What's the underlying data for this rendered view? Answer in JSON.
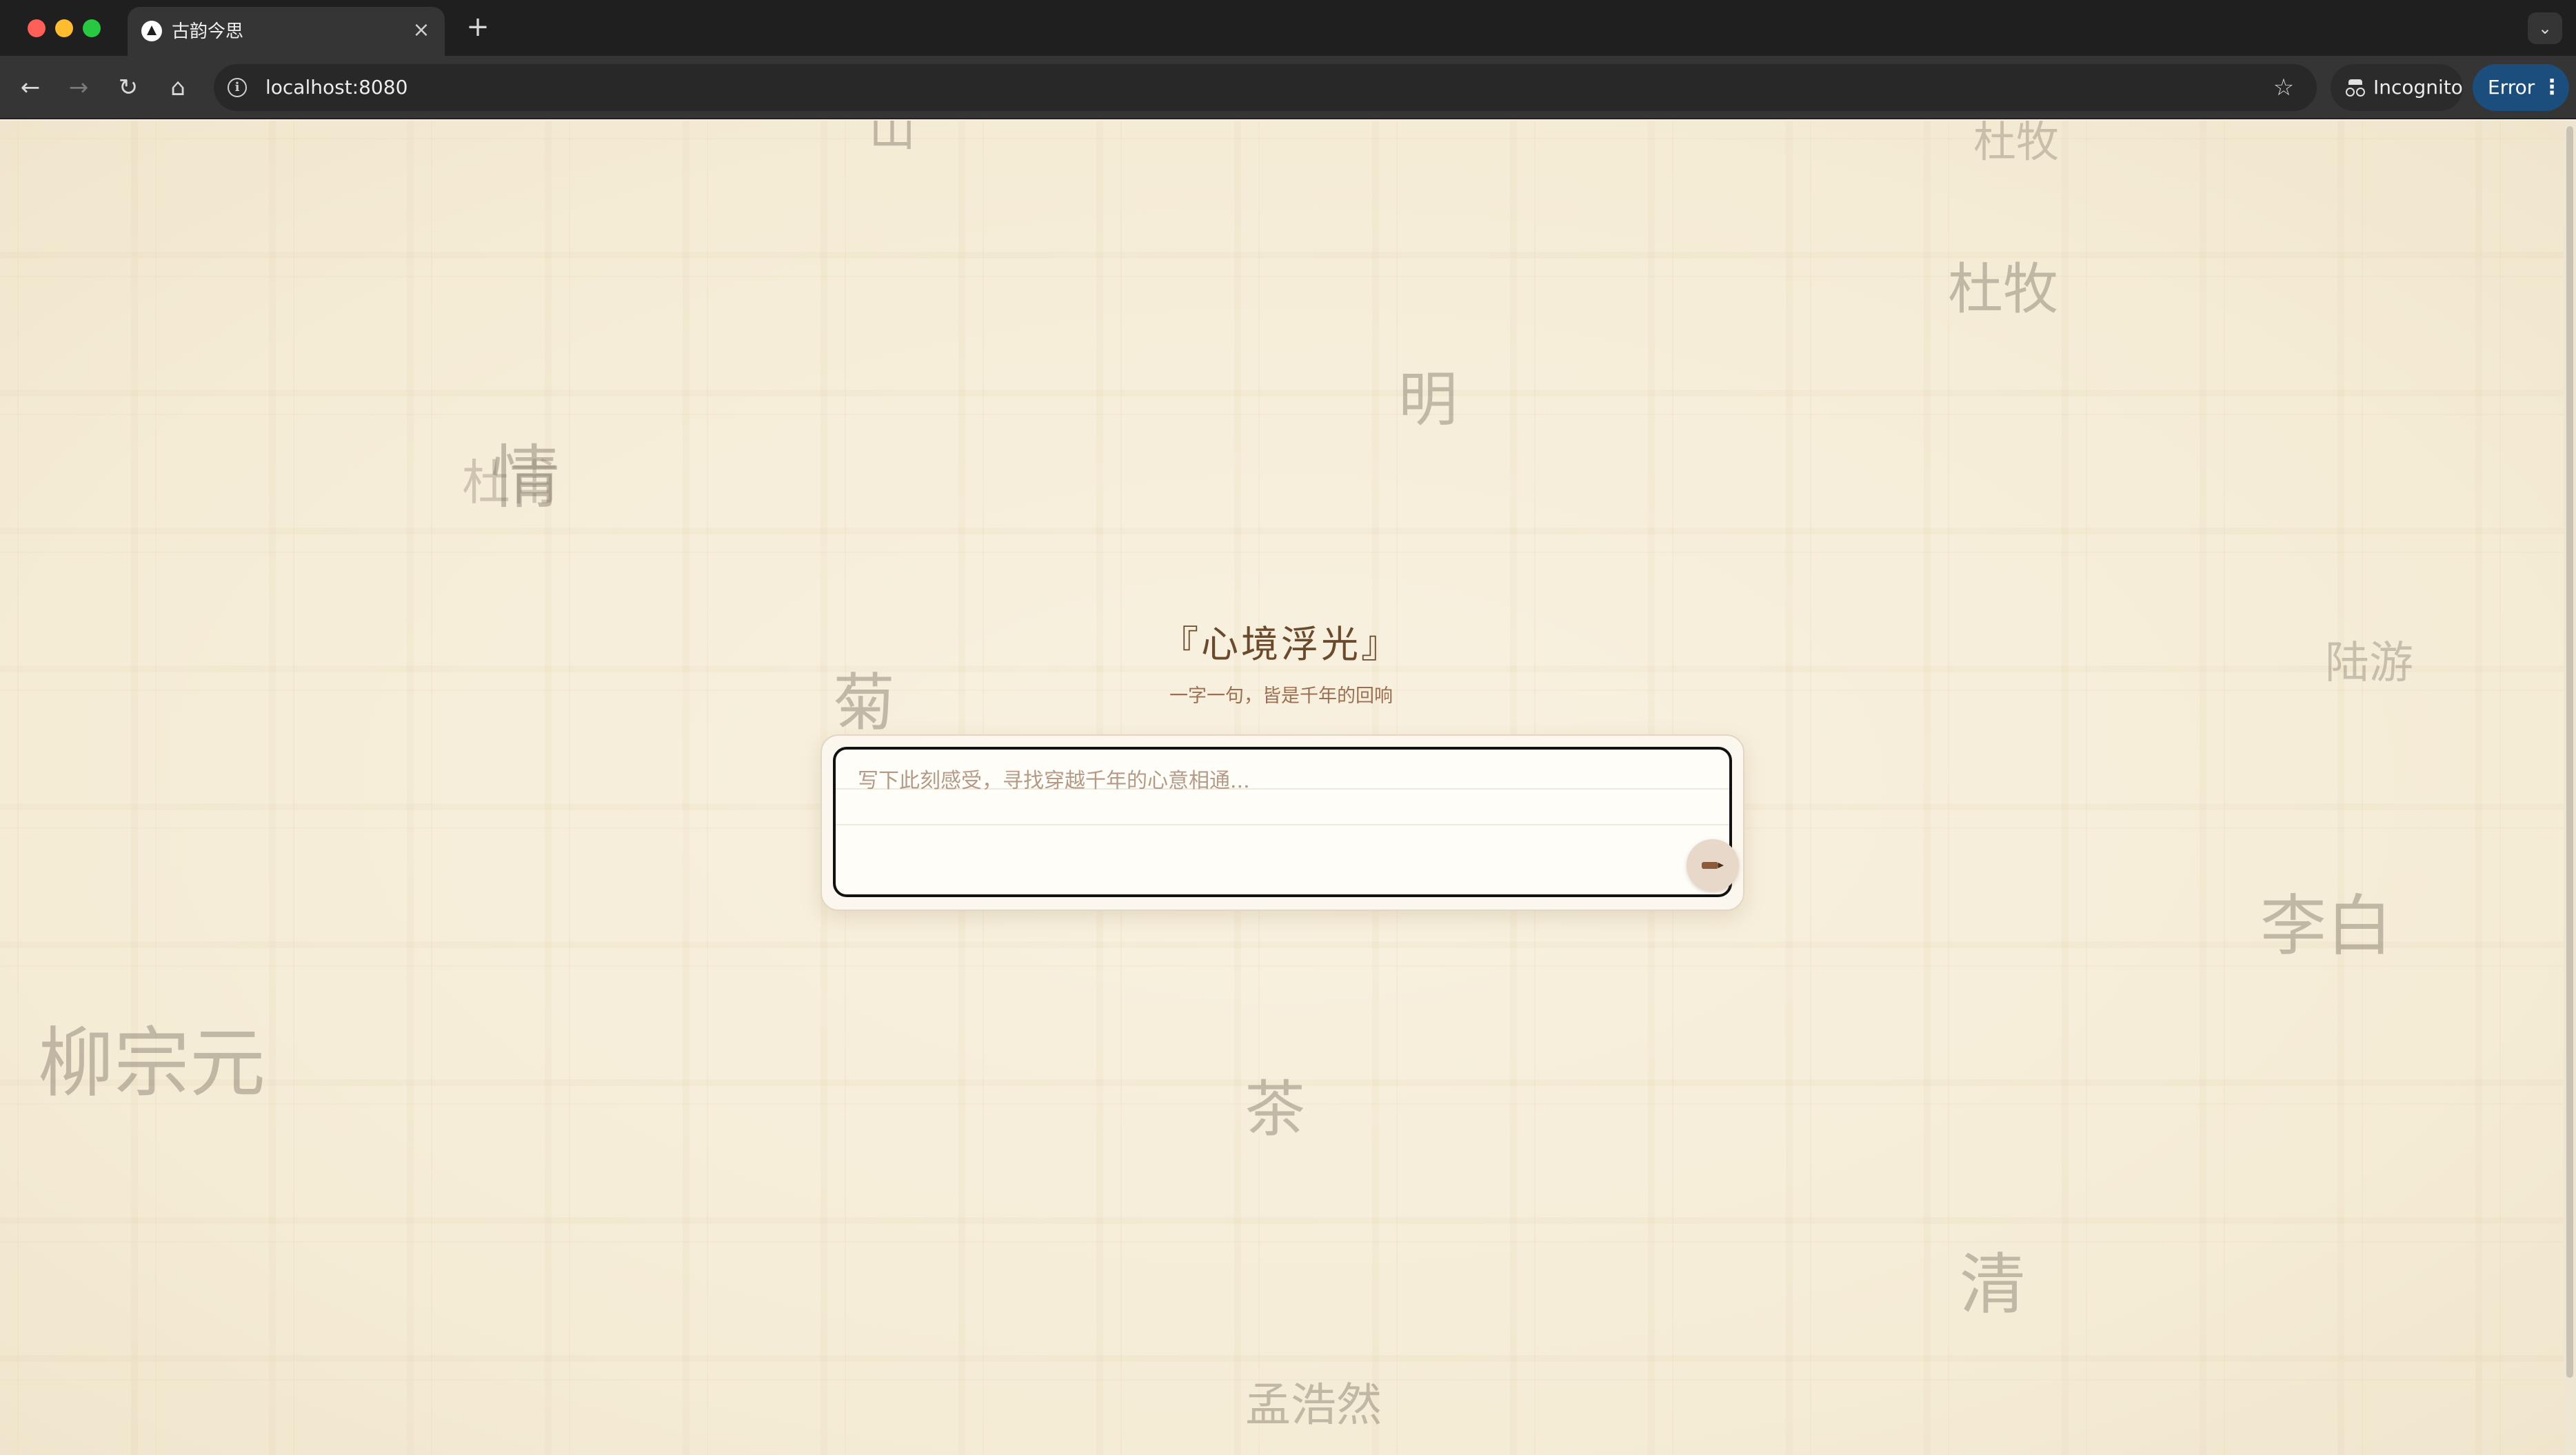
{
  "browser": {
    "tab_title": "古韵今思",
    "tab_close": "×",
    "new_tab": "+",
    "tab_menu": "⌄",
    "url": "localhost:8080",
    "incognito_label": "Incognito",
    "error_label": "Error",
    "icons": {
      "back": "←",
      "forward": "→",
      "reload": "↻",
      "home": "⌂",
      "info": "i",
      "star": "☆",
      "kebab": "⋮"
    }
  },
  "background_chars": [
    "山",
    "杜牧",
    "杜牧",
    "明",
    "杜甫",
    "情",
    "陆游",
    "菊",
    "李白",
    "柳宗元",
    "茶",
    "清",
    "孟浩然"
  ],
  "hero": {
    "title": "『心境浮光』",
    "subtitle": "一字一句，皆是千年的回响"
  },
  "input": {
    "placeholder": "写下此刻感受，寻找穿越千年的心意相通..."
  },
  "colors": {
    "background": "#f6eedb",
    "title": "#6a4a2c",
    "subtitle": "#9b6f52",
    "input_border": "#121212",
    "submit_button": "#e7d8c9"
  }
}
